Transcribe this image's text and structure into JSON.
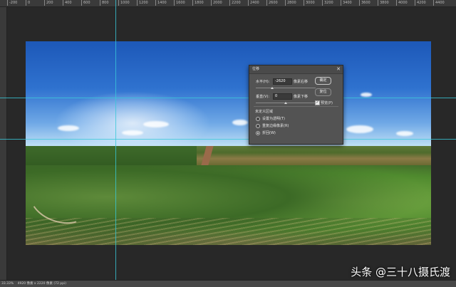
{
  "ruler": {
    "top_labels": [
      "-200",
      "0",
      "200",
      "400",
      "600",
      "800",
      "1000",
      "1200",
      "1400",
      "1600",
      "1800",
      "2000",
      "2200",
      "2400",
      "2600",
      "2800",
      "3000",
      "3200",
      "3400",
      "3600",
      "3800",
      "4000",
      "4200",
      "4400",
      "4600"
    ]
  },
  "dialog": {
    "title": "位移",
    "horizontal_label": "水平(H):",
    "horizontal_value": "-2620",
    "horizontal_unit": "像素右移",
    "vertical_label": "垂直(V):",
    "vertical_value": "0",
    "vertical_unit": "像素下移",
    "undefined_area_title": "未定义区域",
    "radio_transparent": "设置为透明(T)",
    "radio_repeat": "重复边缘像素(R)",
    "radio_wrap": "折回(W)",
    "radio_selected": "折回(W)",
    "ok_button": "确定",
    "reset_button": "复位",
    "preview_label": "预览(P)",
    "preview_checked": true
  },
  "statusbar": {
    "zoom": "33.33%",
    "doc_info": "4920 像素 x 2220 像素 (72 ppi)"
  },
  "watermark": {
    "text": "头条 @三十八摄氏渡"
  },
  "colors": {
    "guide": "#38c8d8",
    "workspace": "#282828",
    "dialog_bg": "#535353"
  }
}
